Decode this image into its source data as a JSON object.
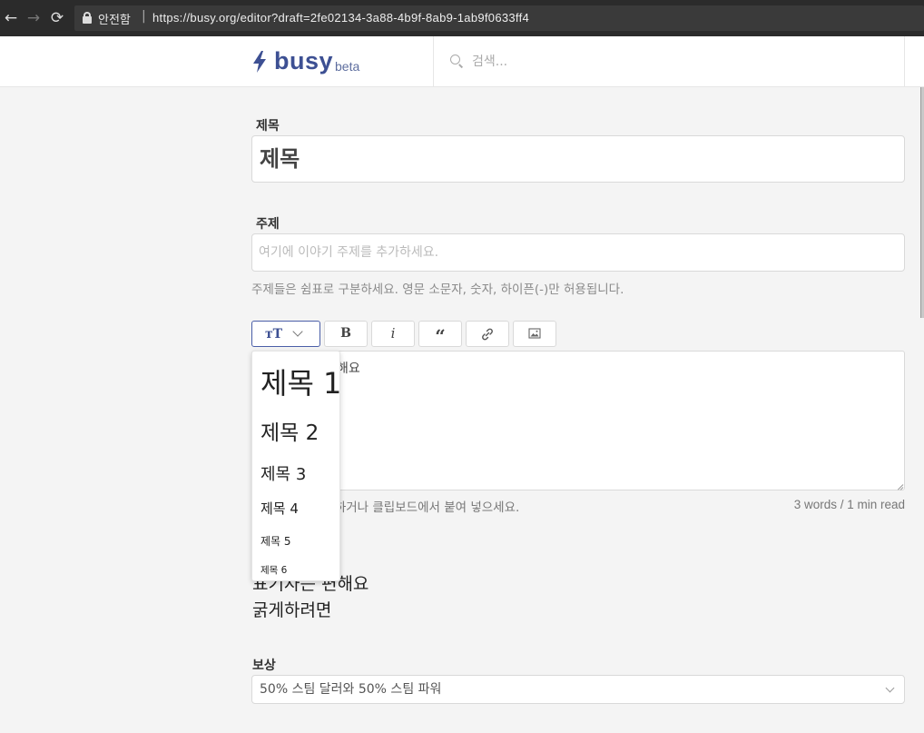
{
  "browser": {
    "back_label": "←",
    "forward_label": "→",
    "reload_label": "⟳",
    "secure_label": "안전함",
    "separator": "|",
    "url": "https://busy.org/editor?draft=2fe02134-3a88-4b9f-8ab9-1ab9f0633ff4"
  },
  "header": {
    "logo_text": "busy",
    "logo_badge": "beta",
    "search_placeholder": "검색..."
  },
  "form": {
    "title_label": "제목",
    "title_value": "제목",
    "topics_label": "주제",
    "topics_placeholder": "여기에 이야기 주제를 추가하세요.",
    "topics_help": "주제들은 쉼표로 구분하세요. 영문 소문자, 숫자, 하이픈(-)만 허용됩니다.",
    "editor_text": "해요",
    "editor_help": "선택하거나 클립보드에서 붙여 넣으세요.",
    "word_count": "3 words / 1 min read",
    "reward_label": "보상",
    "reward_value": "50% 스팀 달러와 50% 스팀 파워"
  },
  "toolbar": {
    "heading_icon": "TT",
    "bold_label": "B",
    "italic_label": "i",
    "quote_label": "“",
    "link_icon": "link-icon",
    "image_icon": "image-icon"
  },
  "heading_menu": {
    "items": [
      "제목 1",
      "제목 2",
      "제목 3",
      "제목 4",
      "제목 5",
      "제목 6"
    ]
  },
  "preview": {
    "lines": [
      "표기자는 편해요",
      "굵게하려면"
    ]
  },
  "colors": {
    "brand": "#3d5093",
    "border": "#d9d9d9",
    "background": "#f4f4f4"
  }
}
